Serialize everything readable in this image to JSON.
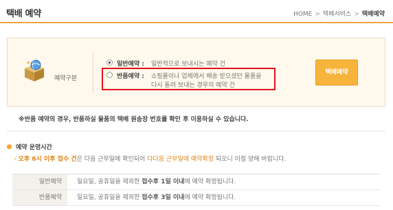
{
  "header": {
    "title": "택배 예약",
    "breadcrumb": [
      "HOME",
      "택배서비스",
      "택배예약"
    ]
  },
  "reservation": {
    "type_label": "예약구분",
    "options": [
      {
        "title": "일반예약 :",
        "desc_line1": "일반적으로 보내시는 예약 건",
        "desc_line2": "",
        "checked": true
      },
      {
        "title": "반품예약 :",
        "desc_line1": "쇼핑몰이나 업체에서 배송 받으셨던 물품을",
        "desc_line2": "다시 돌려 보내는 경우의 예약 건",
        "checked": false
      }
    ],
    "button_label": "택배예약"
  },
  "note": "※반품 예약의 경우, 반품하실 물품의 택배 원송장 번호를 확인 후 이용하실 수 있습니다.",
  "hours": {
    "title": "예약 운영시간",
    "desc_parts": [
      "오후 6시 이후 접수 건",
      "은 다음 근무일에 확인되어",
      "다다음 근무일에 예약확정",
      "되오니 이점 양해 바랍니다."
    ],
    "rows": [
      {
        "label": "일반예약",
        "text_pre": "일요일, 공휴일을 제외한 ",
        "text_bold": "접수후 1일 이내",
        "text_post": "에 예약 확정됩니다."
      },
      {
        "label": "반품예약",
        "text_pre": "일요일, 공휴일을 제외한 ",
        "text_bold": "접수후 3일 이내",
        "text_post": "에 예약 확정됩니다."
      }
    ]
  },
  "colors": {
    "accent": "#f3a52c",
    "highlight_border": "#e3111b",
    "button_bg": "#f7b43b"
  }
}
